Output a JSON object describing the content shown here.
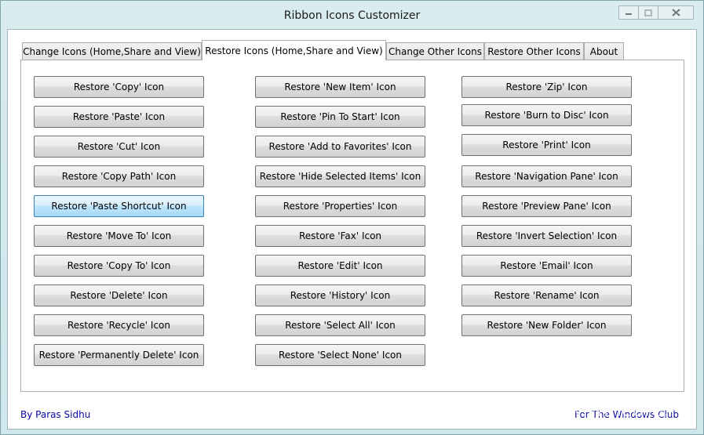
{
  "window": {
    "title": "Ribbon Icons Customizer"
  },
  "tabs": [
    {
      "label": "Change Icons (Home,Share and View)"
    },
    {
      "label": "Restore Icons (Home,Share and View)"
    },
    {
      "label": "Change Other Icons"
    },
    {
      "label": "Restore Other Icons"
    },
    {
      "label": "About"
    }
  ],
  "active_tab": "Restore Icons (Home,Share and View)",
  "columns": [
    {
      "buttons": [
        "Restore 'Copy' Icon",
        "Restore 'Paste' Icon",
        "Restore 'Cut' Icon",
        "Restore 'Copy Path' Icon",
        "Restore 'Paste Shortcut' Icon",
        "Restore 'Move To' Icon",
        "Restore 'Copy To' Icon",
        "Restore 'Delete' Icon",
        "Restore 'Recycle' Icon",
        "Restore 'Permanently Delete' Icon"
      ]
    },
    {
      "buttons": [
        "Restore 'New Item' Icon",
        "Restore 'Pin To Start' Icon",
        "Restore 'Add to Favorites' Icon",
        "Restore 'Hide Selected Items' Icon",
        "Restore 'Properties' Icon",
        "Restore 'Fax' Icon",
        "Restore 'Edit' Icon",
        "Restore 'History' Icon",
        "Restore 'Select All' Icon",
        "Restore 'Select None' Icon"
      ]
    },
    {
      "buttons": [
        "Restore 'Zip' Icon",
        "Restore 'Burn to Disc' Icon",
        "Restore 'Print' Icon",
        "Restore 'Navigation Pane' Icon",
        "Restore 'Preview Pane' Icon",
        "Restore 'Invert Selection' Icon",
        "Restore 'Email' Icon",
        "Restore 'Rename' Icon",
        "Restore 'New Folder' Icon"
      ]
    }
  ],
  "hovered_button": "Restore 'Paste Shortcut' Icon",
  "footer": {
    "author": "By Paras Sidhu",
    "credit": "For The Windows Club"
  },
  "watermark": "www.wincore.ru",
  "caption_icons": [
    "minimize-icon",
    "maximize-icon",
    "close-icon"
  ],
  "colors": {
    "footer_text": "#0a0aa0",
    "hover_accent": "#bee6fd",
    "window_frame": "#d9ecef"
  }
}
